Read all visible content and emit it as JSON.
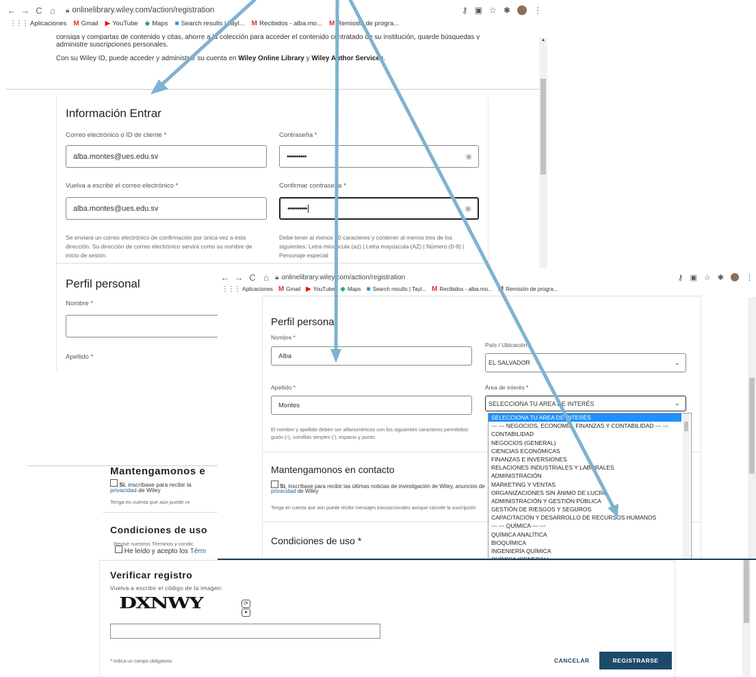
{
  "browser": {
    "url": "onlinelibrary.wiley.com/action/registration",
    "bookmarks": [
      "Aplicaciones",
      "Gmail",
      "YouTube",
      "Maps",
      "Search results | Tayl...",
      "Recibidos - alba.mo...",
      "Remisión de progra..."
    ]
  },
  "top": {
    "intro_line1": "consiga y compartas de contenido y citas, ahorre a la colección para acceder el contenido contratado de su institución, guarde búsquedas y alertas, y",
    "intro_line2": "administre suscripciones personales.",
    "intro_line3_pre": "Con su Wiley ID, puede acceder y administrar su cuenta en",
    "link_wol": "Wiley Online Library",
    "conj": "y",
    "link_was": "Wiley Author Services",
    "period": "."
  },
  "login": {
    "title": "Información Entrar",
    "email_label": "Correo electrónico o ID de cliente *",
    "email_value": "alba.montes@ues.edu.sv",
    "email2_label": "Vuelva a escribir el correo electrónico *",
    "email2_value": "alba.montes@ues.edu.sv",
    "email_help": "Se enviará un correo electrónico de confirmación por única vez a esta dirección. Su dirección de correo electrónico servirá como su nombre de inicio de sesión.",
    "password_label": "Contraseña *",
    "password_value": "••••••••••",
    "confirm_label": "Confirmar contraseña *",
    "confirm_value": "••••••••••",
    "password_help": "Debe tener al menos 10 caracteres y contener al menos tres de los siguientes: Letra minúscula (az) | Letra mayúscula (AZ) | Número (0-9) | Personaje especial"
  },
  "profile_back": {
    "title": "Perfil personal",
    "name_label": "Nombre *",
    "lastname_label": "Apellido *"
  },
  "profile": {
    "title": "Perfil personal",
    "name_label": "Nombre *",
    "name_value": "Alba",
    "lastname_label": "Apellido *",
    "lastname_value": "Montes",
    "name_help": "El nombre y apellido deben ser alfanuméricos con los siguientes caracteres permitidos: guión (-), comillas simples ('), espacio y punto.",
    "country_label": "País / Ubicación *",
    "country_value": "EL SALVADOR",
    "area_label": "Área de interés *",
    "area_value": "SELECCIONA TU AREA DE INTERÉS",
    "area_options": [
      "SELECCIONA TU AREA DE INTERÉS",
      "--- --- NEGOCIOS, ECONOMÍA, FINANZAS Y CONTABILIDAD --- ---",
      "CONTABILIDAD",
      "NEGOCIOS (GENERAL)",
      "CIENCIAS ECONÓMICAS",
      "FINANZAS E INVERSIONES",
      "RELACIONES INDUSTRIALES Y LABORALES",
      "ADMINISTRACIÓN",
      "MARKETING Y VENTAS",
      "ORGANIZACIONES SIN ÁNIMO DE LUCRO",
      "ADMINISTRACIÓN Y GESTIÓN PÚBLICA",
      "GESTIÓN DE RIESGOS Y SEGUROS",
      "CAPACITACIÓN Y DESARROLLO DE RECURSOS HUMANOS",
      "--- --- QUÍMICA --- ---",
      "QUÍMICA ANALÍTICA",
      "BIOQUÍMICA",
      "INGENIERÍA QUÍMICA",
      "QUÍMICA (GENERAL)"
    ]
  },
  "contact": {
    "title": "Mantengamonos en contacto",
    "title_back": "Mantengamonos e",
    "yes": "Sí",
    "optin": ", inscríbase para recibir las últimas noticias de investigación de Wiley, anuncios de",
    "optin_back": ", inscríbase para recibir la",
    "privacy_link": "privacidad",
    "privacy_rest": "de Wiley",
    "note": "Tenga en cuenta que aún puede recibir mensajes transaccionales aunque cancele la suscripción",
    "note_back": "Tenga en cuenta que aún puede re"
  },
  "terms": {
    "title": "Condiciones de uso *",
    "title_back": "Condiciones de uso",
    "review": "Revise nuestros Términos y condic",
    "accept": "He leído y acepto los",
    "accept_link": "Térm"
  },
  "verify": {
    "title": "Verificar registro",
    "instruction": "Vuelva a escribir el código de la imagen:",
    "captcha": "DXNWY",
    "required_note": "* Indica un campo obligatorio",
    "cancel": "CANCELAR",
    "register": "REGISTRARSE"
  },
  "colors": {
    "arrow": "#7fb2d2",
    "brand_button": "#1e4a6a",
    "option_selected": "#1e90ff",
    "link": "#1a5f99"
  }
}
